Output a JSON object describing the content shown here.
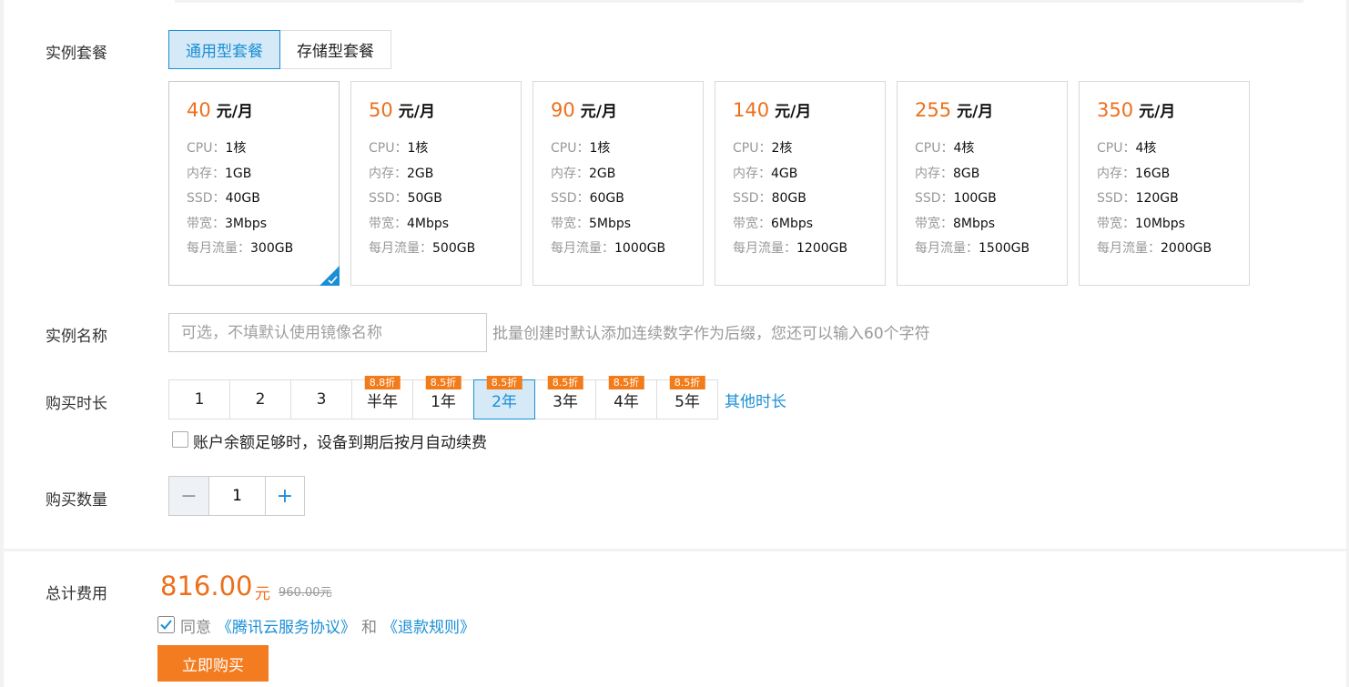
{
  "labels": {
    "plan": "实例套餐",
    "name": "实例名称",
    "duration": "购买时长",
    "quantity": "购买数量",
    "total": "总计费用"
  },
  "plan_types": [
    {
      "label": "通用型套餐",
      "active": true
    },
    {
      "label": "存储型套餐",
      "active": false
    }
  ],
  "plans": [
    {
      "price": "40",
      "unit": "元/月",
      "specs": [
        {
          "key": "CPU：",
          "val": "1核"
        },
        {
          "key": "内存：",
          "val": "1GB"
        },
        {
          "key": "SSD：",
          "val": "40GB"
        },
        {
          "key": "带宽：",
          "val": "3Mbps"
        },
        {
          "key": "每月流量：",
          "val": "300GB"
        }
      ],
      "selected": true
    },
    {
      "price": "50",
      "unit": "元/月",
      "specs": [
        {
          "key": "CPU：",
          "val": "1核"
        },
        {
          "key": "内存：",
          "val": "2GB"
        },
        {
          "key": "SSD：",
          "val": "50GB"
        },
        {
          "key": "带宽：",
          "val": "4Mbps"
        },
        {
          "key": "每月流量：",
          "val": "500GB"
        }
      ],
      "selected": false
    },
    {
      "price": "90",
      "unit": "元/月",
      "specs": [
        {
          "key": "CPU：",
          "val": "1核"
        },
        {
          "key": "内存：",
          "val": "2GB"
        },
        {
          "key": "SSD：",
          "val": "60GB"
        },
        {
          "key": "带宽：",
          "val": "5Mbps"
        },
        {
          "key": "每月流量：",
          "val": "1000GB"
        }
      ],
      "selected": false
    },
    {
      "price": "140",
      "unit": "元/月",
      "specs": [
        {
          "key": "CPU：",
          "val": "2核"
        },
        {
          "key": "内存：",
          "val": "4GB"
        },
        {
          "key": "SSD：",
          "val": "80GB"
        },
        {
          "key": "带宽：",
          "val": "6Mbps"
        },
        {
          "key": "每月流量：",
          "val": "1200GB"
        }
      ],
      "selected": false
    },
    {
      "price": "255",
      "unit": "元/月",
      "specs": [
        {
          "key": "CPU：",
          "val": "4核"
        },
        {
          "key": "内存：",
          "val": "8GB"
        },
        {
          "key": "SSD：",
          "val": "100GB"
        },
        {
          "key": "带宽：",
          "val": "8Mbps"
        },
        {
          "key": "每月流量：",
          "val": "1500GB"
        }
      ],
      "selected": false
    },
    {
      "price": "350",
      "unit": "元/月",
      "specs": [
        {
          "key": "CPU：",
          "val": "4核"
        },
        {
          "key": "内存：",
          "val": "16GB"
        },
        {
          "key": "SSD：",
          "val": "120GB"
        },
        {
          "key": "带宽：",
          "val": "10Mbps"
        },
        {
          "key": "每月流量：",
          "val": "2000GB"
        }
      ],
      "selected": false
    }
  ],
  "name_input": {
    "value": "",
    "placeholder": "可选，不填默认使用镜像名称",
    "hint": "批量创建时默认添加连续数字作为后缀，您还可以输入60个字符"
  },
  "durations": [
    {
      "label": "1",
      "badge": "",
      "active": false
    },
    {
      "label": "2",
      "badge": "",
      "active": false
    },
    {
      "label": "3",
      "badge": "",
      "active": false
    },
    {
      "label": "半年",
      "badge": "8.8折",
      "active": false
    },
    {
      "label": "1年",
      "badge": "8.5折",
      "active": false
    },
    {
      "label": "2年",
      "badge": "8.5折",
      "active": true
    },
    {
      "label": "3年",
      "badge": "8.5折",
      "active": false
    },
    {
      "label": "4年",
      "badge": "8.5折",
      "active": false
    },
    {
      "label": "5年",
      "badge": "8.5折",
      "active": false
    }
  ],
  "other_duration": "其他时长",
  "auto_renew": {
    "label": "账户余额足够时，设备到期后按月自动续费",
    "checked": false
  },
  "quantity": {
    "minus": "−",
    "value": "1",
    "plus": "+"
  },
  "total": {
    "amount": "816.00",
    "unit": "元",
    "original": "960.00元"
  },
  "agreement": {
    "prefix": "同意",
    "link1": "《腾讯云服务协议》",
    "and": "和",
    "link2": "《退款规则》",
    "checked": true
  },
  "buy_button": "立即购买",
  "colors": {
    "accent": "#1a8fd6",
    "price": "#ed6f1b",
    "buy": "#f47c20",
    "badge": "#f27c1a"
  }
}
